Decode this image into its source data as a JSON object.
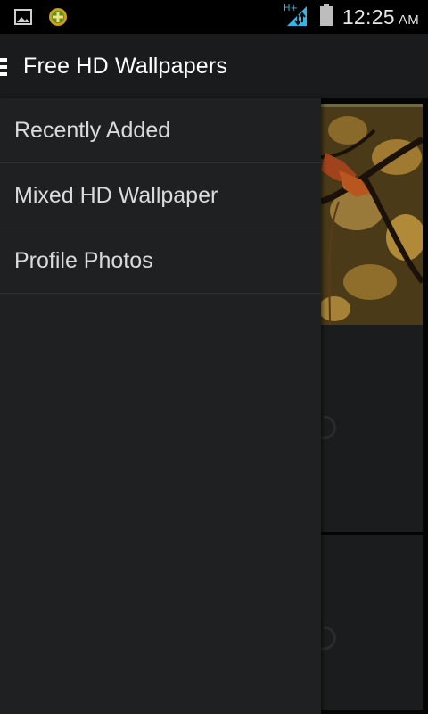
{
  "status_bar": {
    "time": "12:25",
    "ampm": "AM",
    "network_type": "H+",
    "icons": [
      "image-icon",
      "app-notification-icon",
      "signal-icon",
      "battery-icon"
    ]
  },
  "action_bar": {
    "title": "Free HD Wallpapers"
  },
  "drawer": {
    "items": [
      {
        "label": "Recently Added"
      },
      {
        "label": "Mixed HD Wallpaper"
      },
      {
        "label": "Profile Photos"
      }
    ]
  },
  "colors": {
    "drawer_bg": "#1f2022",
    "action_bar_bg": "#1a1b1d",
    "status_bar_bg": "#000000",
    "network_accent": "#33b5e5"
  }
}
